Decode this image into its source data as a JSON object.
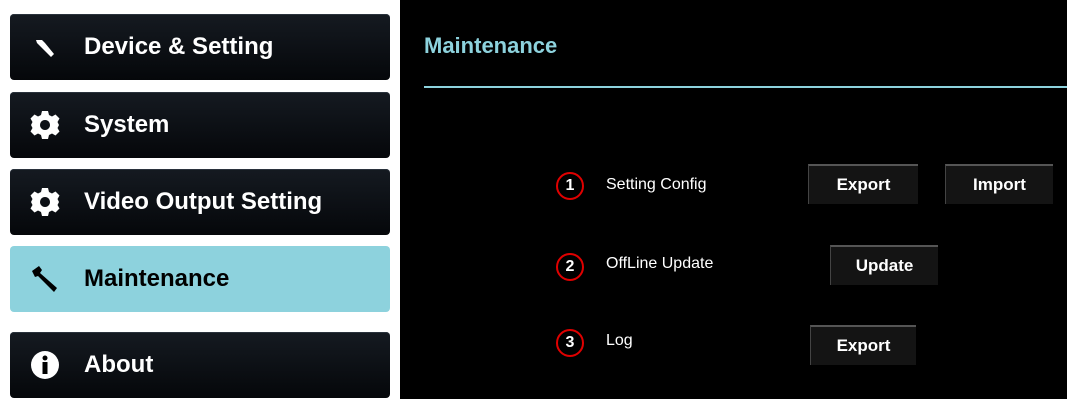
{
  "sidebar": {
    "items": [
      {
        "label": "Device & Setting",
        "icon": "wrench-icon"
      },
      {
        "label": "System",
        "icon": "gear-icon"
      },
      {
        "label": "Video Output Setting",
        "icon": "gear-icon"
      },
      {
        "label": "Maintenance",
        "icon": "wrench-icon",
        "active": true
      },
      {
        "label": "About",
        "icon": "info-icon"
      }
    ]
  },
  "main": {
    "title": "Maintenance",
    "rows": [
      {
        "number": "1",
        "label": "Setting Config",
        "buttons": [
          "Export",
          "Import"
        ]
      },
      {
        "number": "2",
        "label": "OffLine Update",
        "buttons": [
          "Update"
        ]
      },
      {
        "number": "3",
        "label": "Log",
        "buttons": [
          "Export"
        ]
      }
    ]
  },
  "colors": {
    "accent": "#8dd2dd",
    "marker_border": "#e00000",
    "sidebar_bg": "#ffffff",
    "main_bg": "#000000"
  }
}
